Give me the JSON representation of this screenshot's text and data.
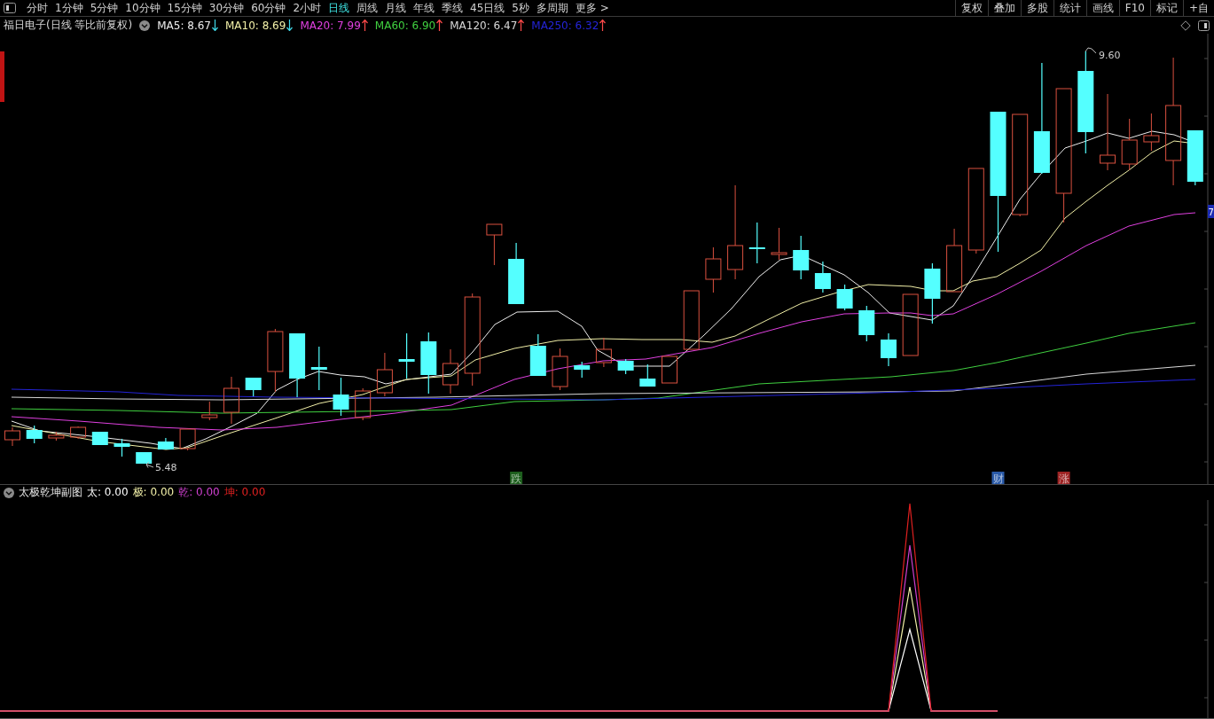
{
  "toolbar": {
    "tabs": [
      {
        "label": "分时",
        "selected": false
      },
      {
        "label": "1分钟",
        "selected": false
      },
      {
        "label": "5分钟",
        "selected": false
      },
      {
        "label": "10分钟",
        "selected": false
      },
      {
        "label": "15分钟",
        "selected": false
      },
      {
        "label": "30分钟",
        "selected": false
      },
      {
        "label": "60分钟",
        "selected": false
      },
      {
        "label": "2小时",
        "selected": false
      },
      {
        "label": "日线",
        "selected": true
      },
      {
        "label": "周线",
        "selected": false
      },
      {
        "label": "月线",
        "selected": false
      },
      {
        "label": "年线",
        "selected": false
      },
      {
        "label": "季线",
        "selected": false
      },
      {
        "label": "45日线",
        "selected": false
      },
      {
        "label": "5秒",
        "selected": false
      },
      {
        "label": "多周期",
        "selected": false
      },
      {
        "label": "更多 >",
        "selected": false
      }
    ],
    "buttons": [
      "复权",
      "叠加",
      "多股",
      "统计",
      "画线",
      "F10",
      "标记",
      "+自"
    ]
  },
  "legend": {
    "title": "福日电子(日线 等比前复权)",
    "averages": [
      {
        "label": "MA5: 8.67",
        "color": "#eeeeee",
        "rising": false
      },
      {
        "label": "MA10: 8.69",
        "color": "#f2f0a8",
        "rising": false
      },
      {
        "label": "MA20: 7.99",
        "color": "#e040e0",
        "rising": true
      },
      {
        "label": "MA60: 6.90",
        "color": "#40d040",
        "rising": true
      },
      {
        "label": "MA120: 6.47",
        "color": "#d8d8d8",
        "rising": true
      },
      {
        "label": "MA250: 6.32",
        "color": "#2424d8",
        "rising": true
      }
    ]
  },
  "main_chart": {
    "high_label": "9.60",
    "low_label": "5.48",
    "price_tag": "7",
    "signals": [
      {
        "text": "跌",
        "color": "#1d5e1d"
      },
      {
        "text": "财",
        "color": "#2a5aa8"
      },
      {
        "text": "涨",
        "color": "#9e2424"
      }
    ]
  },
  "indicator": {
    "title": "太极乾坤副图",
    "values": [
      {
        "label": "太: 0.00",
        "color": "#ffffff"
      },
      {
        "label": "极: 0.00",
        "color": "#f2f0a8"
      },
      {
        "label": "乾: 0.00",
        "color": "#d040d0"
      },
      {
        "label": "坤: 0.00",
        "color": "#e02020"
      }
    ]
  }
}
